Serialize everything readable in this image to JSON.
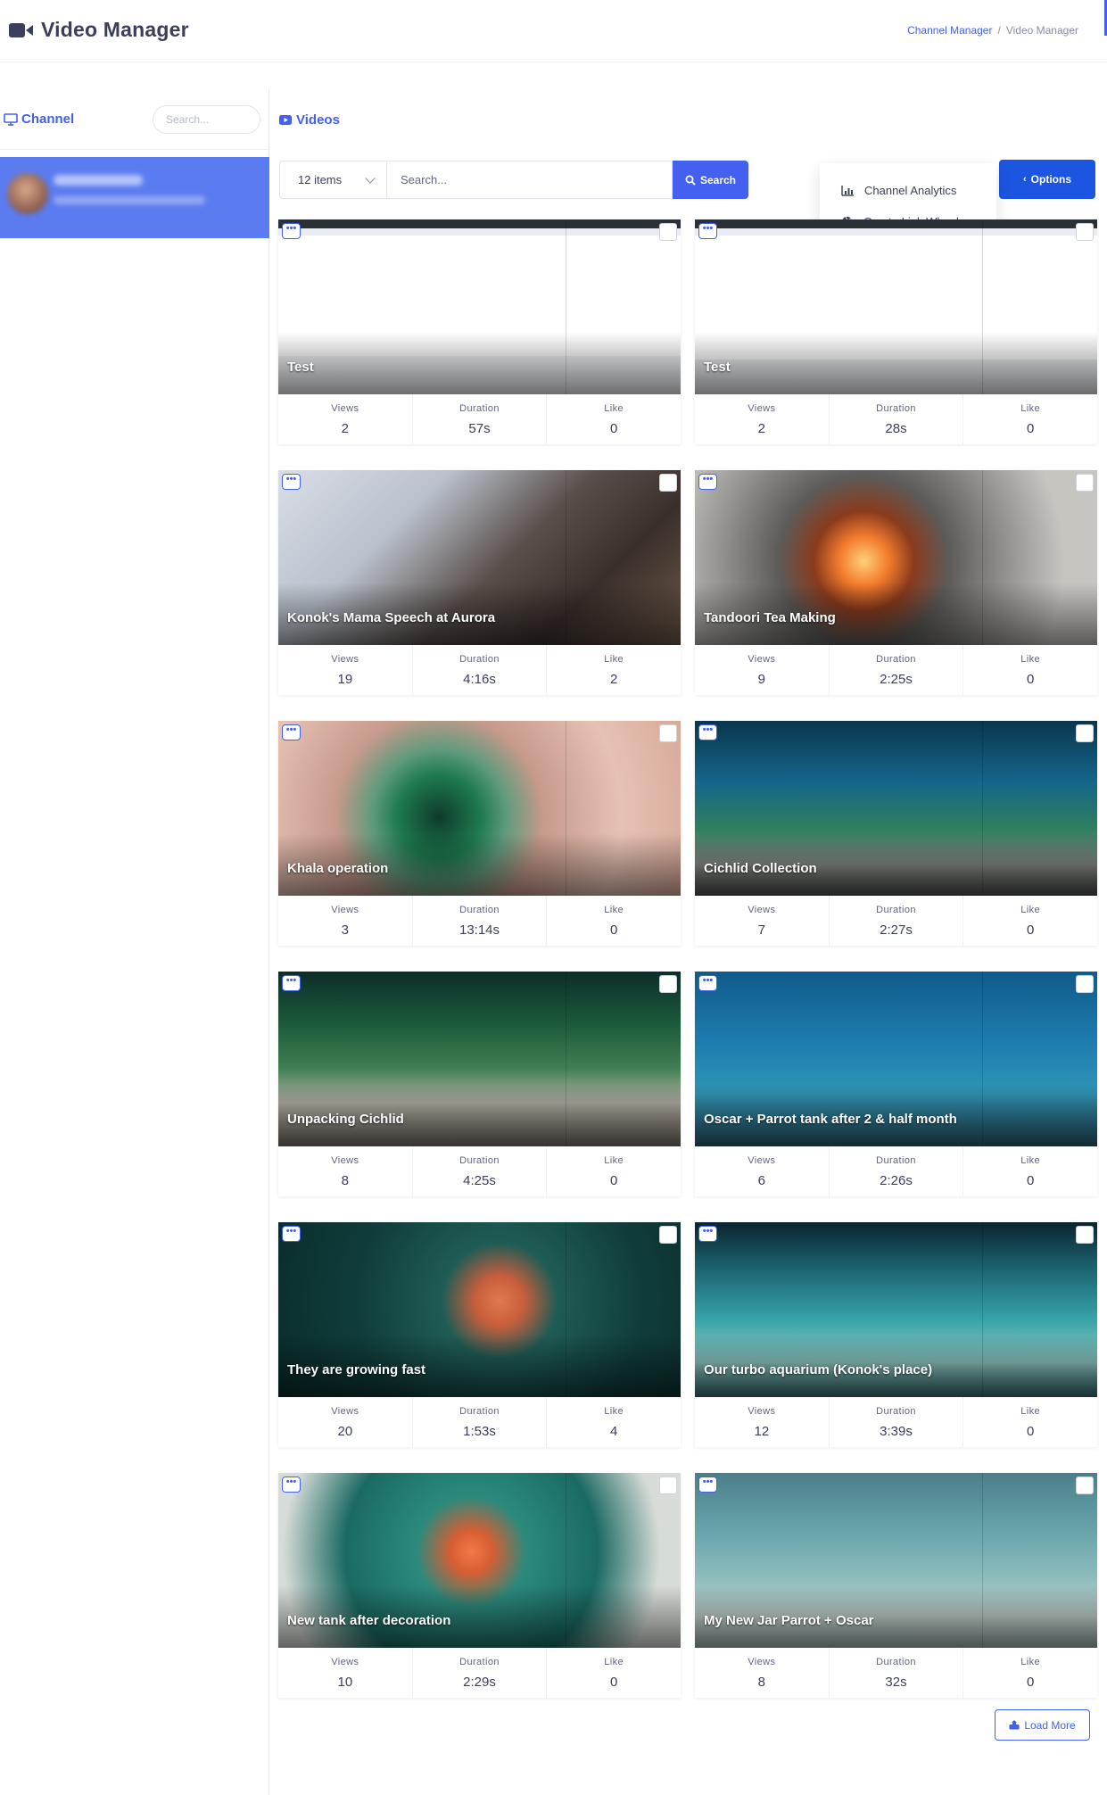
{
  "header": {
    "title": "Video Manager",
    "breadcrumb": [
      {
        "label": "Channel Manager"
      },
      {
        "label": "Video Manager"
      }
    ]
  },
  "sidebar": {
    "title": "Channel",
    "search_placeholder": "Search..."
  },
  "main": {
    "title": "Videos",
    "items_select": "12 items",
    "search_placeholder": "Search...",
    "search_button": "Search",
    "options_button": "Options",
    "options_menu": [
      {
        "label": "Channel Analytics",
        "icon": "chart-icon"
      },
      {
        "label": "Create Link Wheel",
        "icon": "dribbble-icon"
      }
    ],
    "load_more": "Load More"
  },
  "stat_labels": {
    "views": "Views",
    "duration": "Duration",
    "like": "Like"
  },
  "videos": [
    {
      "title": "Test",
      "views": "2",
      "duration": "57s",
      "likes": "0",
      "theme": "screen"
    },
    {
      "title": "Test",
      "views": "2",
      "duration": "28s",
      "likes": "0",
      "theme": "screen2"
    },
    {
      "title": "Konok's Mama Speech at Aurora",
      "views": "19",
      "duration": "4:16s",
      "likes": "2",
      "theme": "hall"
    },
    {
      "title": "Tandoori Tea Making",
      "views": "9",
      "duration": "2:25s",
      "likes": "0",
      "theme": "fire"
    },
    {
      "title": "Khala operation",
      "views": "3",
      "duration": "13:14s",
      "likes": "0",
      "theme": "eye"
    },
    {
      "title": "Cichlid Collection",
      "views": "7",
      "duration": "2:27s",
      "likes": "0",
      "theme": "tank"
    },
    {
      "title": "Unpacking Cichlid",
      "views": "8",
      "duration": "4:25s",
      "likes": "0",
      "theme": "plants"
    },
    {
      "title": "Oscar + Parrot tank after 2 & half month",
      "views": "6",
      "duration": "2:26s",
      "likes": "0",
      "theme": "blue"
    },
    {
      "title": "They are growing fast",
      "views": "20",
      "duration": "1:53s",
      "likes": "4",
      "theme": "green"
    },
    {
      "title": "Our turbo aquarium (Konok's place)",
      "views": "12",
      "duration": "3:39s",
      "likes": "0",
      "theme": "teal"
    },
    {
      "title": "New tank after decoration",
      "views": "10",
      "duration": "2:29s",
      "likes": "0",
      "theme": "deco"
    },
    {
      "title": "My New Jar Parrot + Oscar",
      "views": "8",
      "duration": "32s",
      "likes": "0",
      "theme": "jar"
    }
  ]
}
